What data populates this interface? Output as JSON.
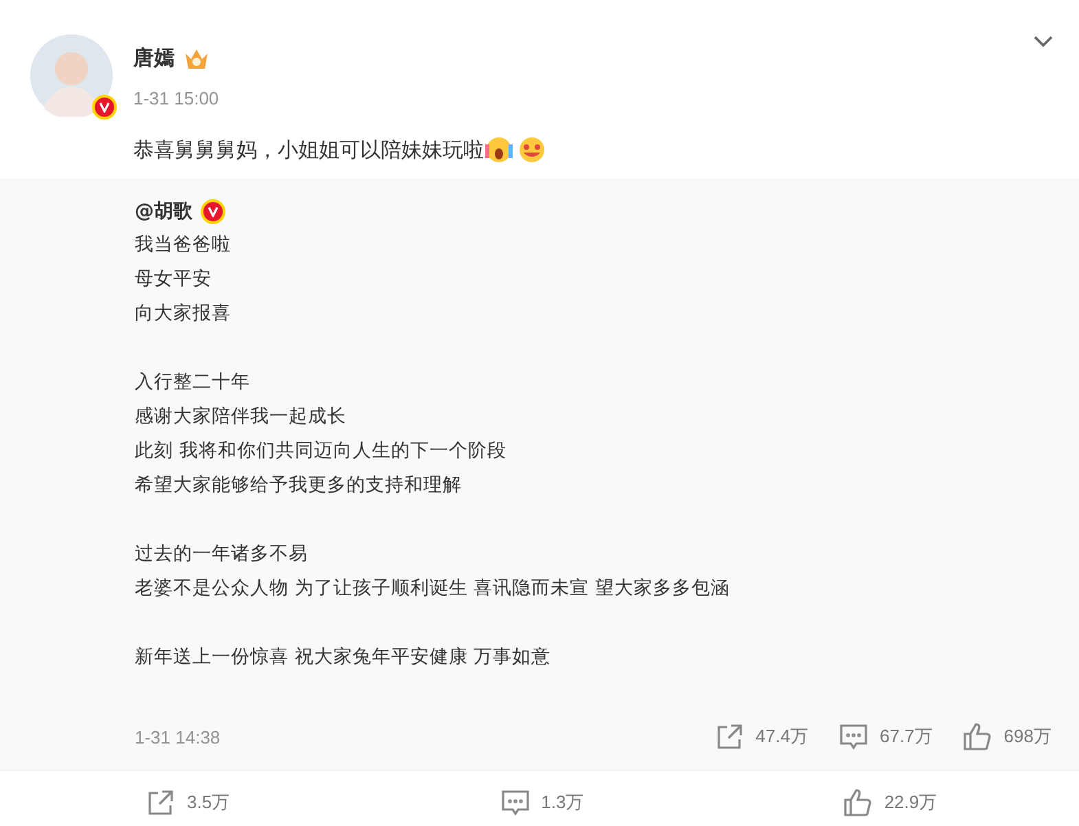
{
  "post": {
    "author": "唐嫣",
    "verified": true,
    "time": "1-31 15:00",
    "text": "恭喜舅舅舅妈，小姐姐可以陪妹妹玩啦"
  },
  "repost": {
    "author": "@胡歌",
    "verified": true,
    "paragraphs": [
      [
        "我当爸爸啦",
        "母女平安",
        "向大家报喜"
      ],
      [
        "入行整二十年",
        "感谢大家陪伴我一起成长",
        "此刻 我将和你们共同迈向人生的下一个阶段",
        "希望大家能够给予我更多的支持和理解"
      ],
      [
        "过去的一年诸多不易",
        "老婆不是公众人物 为了让孩子顺利诞生 喜讯隐而未宣 望大家多多包涵"
      ],
      [
        "新年送上一份惊喜 祝大家兔年平安健康 万事如意"
      ]
    ],
    "time": "1-31 14:38",
    "stats": [
      {
        "kind": "share",
        "count": "47.4万"
      },
      {
        "kind": "comment",
        "count": "67.7万"
      },
      {
        "kind": "like",
        "count": "698万"
      }
    ]
  },
  "actions": [
    {
      "kind": "share",
      "count": "3.5万"
    },
    {
      "kind": "comment",
      "count": "1.3万"
    },
    {
      "kind": "like",
      "count": "22.9万"
    }
  ]
}
